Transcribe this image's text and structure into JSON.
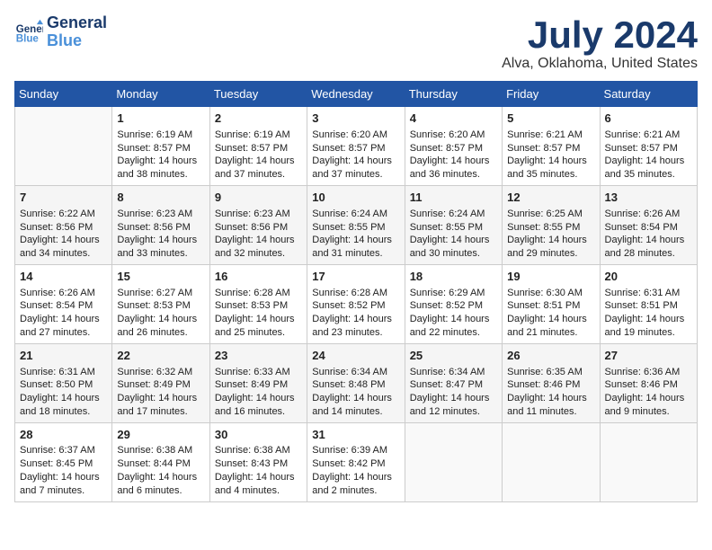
{
  "logo": {
    "line1": "General",
    "line2": "Blue"
  },
  "title": "July 2024",
  "subtitle": "Alva, Oklahoma, United States",
  "days_of_week": [
    "Sunday",
    "Monday",
    "Tuesday",
    "Wednesday",
    "Thursday",
    "Friday",
    "Saturday"
  ],
  "weeks": [
    [
      {
        "day": "",
        "info": ""
      },
      {
        "day": "1",
        "info": "Sunrise: 6:19 AM\nSunset: 8:57 PM\nDaylight: 14 hours\nand 38 minutes."
      },
      {
        "day": "2",
        "info": "Sunrise: 6:19 AM\nSunset: 8:57 PM\nDaylight: 14 hours\nand 37 minutes."
      },
      {
        "day": "3",
        "info": "Sunrise: 6:20 AM\nSunset: 8:57 PM\nDaylight: 14 hours\nand 37 minutes."
      },
      {
        "day": "4",
        "info": "Sunrise: 6:20 AM\nSunset: 8:57 PM\nDaylight: 14 hours\nand 36 minutes."
      },
      {
        "day": "5",
        "info": "Sunrise: 6:21 AM\nSunset: 8:57 PM\nDaylight: 14 hours\nand 35 minutes."
      },
      {
        "day": "6",
        "info": "Sunrise: 6:21 AM\nSunset: 8:57 PM\nDaylight: 14 hours\nand 35 minutes."
      }
    ],
    [
      {
        "day": "7",
        "info": "Sunrise: 6:22 AM\nSunset: 8:56 PM\nDaylight: 14 hours\nand 34 minutes."
      },
      {
        "day": "8",
        "info": "Sunrise: 6:23 AM\nSunset: 8:56 PM\nDaylight: 14 hours\nand 33 minutes."
      },
      {
        "day": "9",
        "info": "Sunrise: 6:23 AM\nSunset: 8:56 PM\nDaylight: 14 hours\nand 32 minutes."
      },
      {
        "day": "10",
        "info": "Sunrise: 6:24 AM\nSunset: 8:55 PM\nDaylight: 14 hours\nand 31 minutes."
      },
      {
        "day": "11",
        "info": "Sunrise: 6:24 AM\nSunset: 8:55 PM\nDaylight: 14 hours\nand 30 minutes."
      },
      {
        "day": "12",
        "info": "Sunrise: 6:25 AM\nSunset: 8:55 PM\nDaylight: 14 hours\nand 29 minutes."
      },
      {
        "day": "13",
        "info": "Sunrise: 6:26 AM\nSunset: 8:54 PM\nDaylight: 14 hours\nand 28 minutes."
      }
    ],
    [
      {
        "day": "14",
        "info": "Sunrise: 6:26 AM\nSunset: 8:54 PM\nDaylight: 14 hours\nand 27 minutes."
      },
      {
        "day": "15",
        "info": "Sunrise: 6:27 AM\nSunset: 8:53 PM\nDaylight: 14 hours\nand 26 minutes."
      },
      {
        "day": "16",
        "info": "Sunrise: 6:28 AM\nSunset: 8:53 PM\nDaylight: 14 hours\nand 25 minutes."
      },
      {
        "day": "17",
        "info": "Sunrise: 6:28 AM\nSunset: 8:52 PM\nDaylight: 14 hours\nand 23 minutes."
      },
      {
        "day": "18",
        "info": "Sunrise: 6:29 AM\nSunset: 8:52 PM\nDaylight: 14 hours\nand 22 minutes."
      },
      {
        "day": "19",
        "info": "Sunrise: 6:30 AM\nSunset: 8:51 PM\nDaylight: 14 hours\nand 21 minutes."
      },
      {
        "day": "20",
        "info": "Sunrise: 6:31 AM\nSunset: 8:51 PM\nDaylight: 14 hours\nand 19 minutes."
      }
    ],
    [
      {
        "day": "21",
        "info": "Sunrise: 6:31 AM\nSunset: 8:50 PM\nDaylight: 14 hours\nand 18 minutes."
      },
      {
        "day": "22",
        "info": "Sunrise: 6:32 AM\nSunset: 8:49 PM\nDaylight: 14 hours\nand 17 minutes."
      },
      {
        "day": "23",
        "info": "Sunrise: 6:33 AM\nSunset: 8:49 PM\nDaylight: 14 hours\nand 16 minutes."
      },
      {
        "day": "24",
        "info": "Sunrise: 6:34 AM\nSunset: 8:48 PM\nDaylight: 14 hours\nand 14 minutes."
      },
      {
        "day": "25",
        "info": "Sunrise: 6:34 AM\nSunset: 8:47 PM\nDaylight: 14 hours\nand 12 minutes."
      },
      {
        "day": "26",
        "info": "Sunrise: 6:35 AM\nSunset: 8:46 PM\nDaylight: 14 hours\nand 11 minutes."
      },
      {
        "day": "27",
        "info": "Sunrise: 6:36 AM\nSunset: 8:46 PM\nDaylight: 14 hours\nand 9 minutes."
      }
    ],
    [
      {
        "day": "28",
        "info": "Sunrise: 6:37 AM\nSunset: 8:45 PM\nDaylight: 14 hours\nand 7 minutes."
      },
      {
        "day": "29",
        "info": "Sunrise: 6:38 AM\nSunset: 8:44 PM\nDaylight: 14 hours\nand 6 minutes."
      },
      {
        "day": "30",
        "info": "Sunrise: 6:38 AM\nSunset: 8:43 PM\nDaylight: 14 hours\nand 4 minutes."
      },
      {
        "day": "31",
        "info": "Sunrise: 6:39 AM\nSunset: 8:42 PM\nDaylight: 14 hours\nand 2 minutes."
      },
      {
        "day": "",
        "info": ""
      },
      {
        "day": "",
        "info": ""
      },
      {
        "day": "",
        "info": ""
      }
    ]
  ]
}
